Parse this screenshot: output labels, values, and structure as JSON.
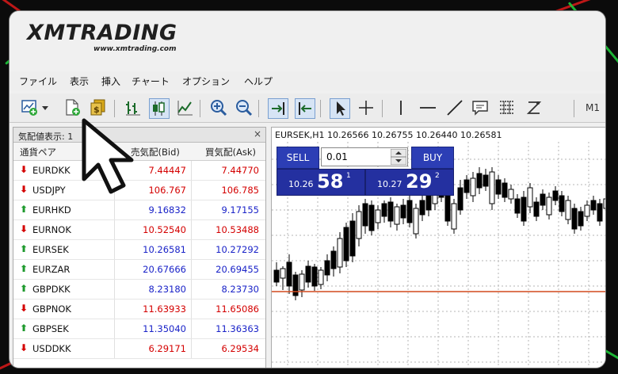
{
  "brand": {
    "logo_text": "XMTRADING",
    "url": "www.xmtrading.com"
  },
  "menu": [
    "ファイル",
    "表示",
    "挿入",
    "チャート",
    "オプション",
    "ヘルプ"
  ],
  "toolbar": {
    "icons": [
      "new-chart-icon",
      "profiles-icon",
      "new-order-icon",
      "market-watch-icon",
      "bar-chart-icon",
      "candlestick-icon",
      "line-chart-icon",
      "zoom-in-icon",
      "zoom-out-icon",
      "autoscroll-icon",
      "chart-shift-icon",
      "cursor-icon",
      "crosshair-icon",
      "vertical-line-icon",
      "horizontal-line-icon",
      "trendline-icon",
      "text-label-icon",
      "fibonacci-icon",
      "periods-icon"
    ],
    "timeframe": "M1"
  },
  "market_watch": {
    "title": "気配値表示: 1",
    "title_suffix": "4",
    "headers": {
      "symbol": "通貨ペア",
      "bid": "売気配(Bid)",
      "ask": "買気配(Ask)"
    },
    "rows": [
      {
        "symbol": "EURDKK",
        "bid": "7.44447",
        "ask": "7.44770",
        "dir": "down",
        "color": "#d40000"
      },
      {
        "symbol": "USDJPY",
        "bid": "106.767",
        "ask": "106.785",
        "dir": "down",
        "color": "#d40000"
      },
      {
        "symbol": "EURHKD",
        "bid": "9.16832",
        "ask": "9.17155",
        "dir": "up",
        "color": "#1a23c8"
      },
      {
        "symbol": "EURNOK",
        "bid": "10.52540",
        "ask": "10.53488",
        "dir": "down",
        "color": "#d40000"
      },
      {
        "symbol": "EURSEK",
        "bid": "10.26581",
        "ask": "10.27292",
        "dir": "up",
        "color": "#1a23c8"
      },
      {
        "symbol": "EURZAR",
        "bid": "20.67666",
        "ask": "20.69455",
        "dir": "up",
        "color": "#1a23c8"
      },
      {
        "symbol": "GBPDKK",
        "bid": "8.23180",
        "ask": "8.23730",
        "dir": "up",
        "color": "#1a23c8"
      },
      {
        "symbol": "GBPNOK",
        "bid": "11.63933",
        "ask": "11.65086",
        "dir": "down",
        "color": "#d40000"
      },
      {
        "symbol": "GBPSEK",
        "bid": "11.35040",
        "ask": "11.36363",
        "dir": "up",
        "color": "#1a23c8"
      },
      {
        "symbol": "USDDKK",
        "bid": "6.29171",
        "ask": "6.29534",
        "dir": "down",
        "color": "#d40000"
      }
    ]
  },
  "chart": {
    "info": "EURSEK,H1  10.26566 10.26755 10.26440 10.26581",
    "trade": {
      "sell_label": "SELL",
      "buy_label": "BUY",
      "lot": "0.01",
      "sell_small": "10.26",
      "sell_big": "58",
      "sell_sup": "1",
      "buy_small": "10.27",
      "buy_big": "29",
      "buy_sup": "2"
    },
    "price_line_color": "#d24a1e"
  }
}
